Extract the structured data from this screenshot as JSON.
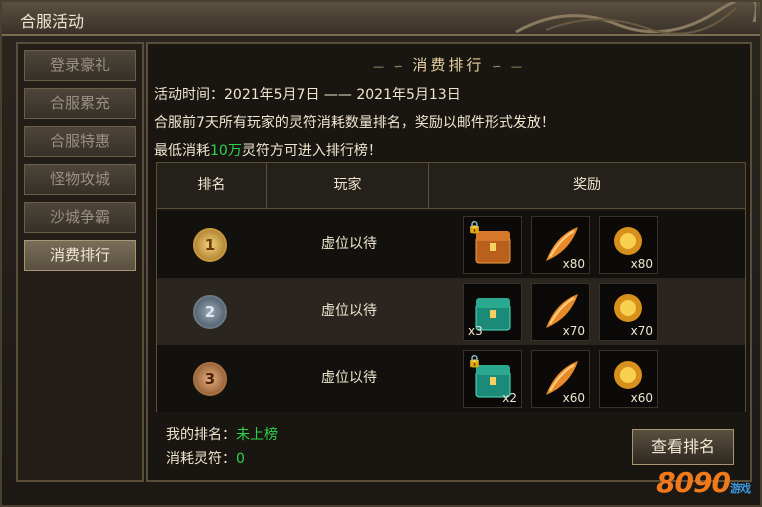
{
  "window": {
    "title": "合服活动"
  },
  "sidebar": {
    "items": [
      {
        "label": "登录豪礼"
      },
      {
        "label": "合服累充"
      },
      {
        "label": "合服特惠"
      },
      {
        "label": "怪物攻城"
      },
      {
        "label": "沙城争霸"
      },
      {
        "label": "消费排行",
        "active": true
      }
    ]
  },
  "panel": {
    "heading": "消费排行",
    "time_line": "活动时间：2021年5月7日 —— 2021年5月13日",
    "desc_line": "合服前7天所有玩家的灵符消耗数量排名，奖励以邮件形式发放！",
    "min_prefix": "最低消耗",
    "min_amount": "10万",
    "min_suffix": "灵符方可进入排行榜！"
  },
  "table": {
    "headers": {
      "rank": "排名",
      "player": "玩家",
      "reward": "奖励"
    },
    "rows": [
      {
        "rank": "1",
        "player": "虚位以待",
        "rewards": [
          {
            "icon": "locked-orange-chest-icon",
            "count": ""
          },
          {
            "icon": "fire-feather-icon",
            "count": "x80"
          },
          {
            "icon": "gold-orb-icon",
            "count": "x80"
          }
        ]
      },
      {
        "rank": "2",
        "player": "虚位以待",
        "rewards": [
          {
            "icon": "jade-chest-icon",
            "count": "x3"
          },
          {
            "icon": "fire-feather-icon",
            "count": "x70"
          },
          {
            "icon": "gold-orb-icon",
            "count": "x70"
          }
        ]
      },
      {
        "rank": "3",
        "player": "虚位以待",
        "rewards": [
          {
            "icon": "locked-jade-chest-icon",
            "count": "x2"
          },
          {
            "icon": "fire-feather-icon",
            "count": "x60"
          },
          {
            "icon": "gold-orb-icon",
            "count": "x60"
          }
        ]
      }
    ]
  },
  "footer": {
    "my_rank_label": "我的排名：",
    "my_rank_value": "未上榜",
    "spent_label": "消耗灵符：",
    "spent_value": "0",
    "view_button": "查看排名"
  },
  "watermark": {
    "logo_number": "8090",
    "logo_tag": "游戏"
  },
  "colors": {
    "accent_green": "#2ed44c",
    "gold": "#e8d2a0"
  }
}
